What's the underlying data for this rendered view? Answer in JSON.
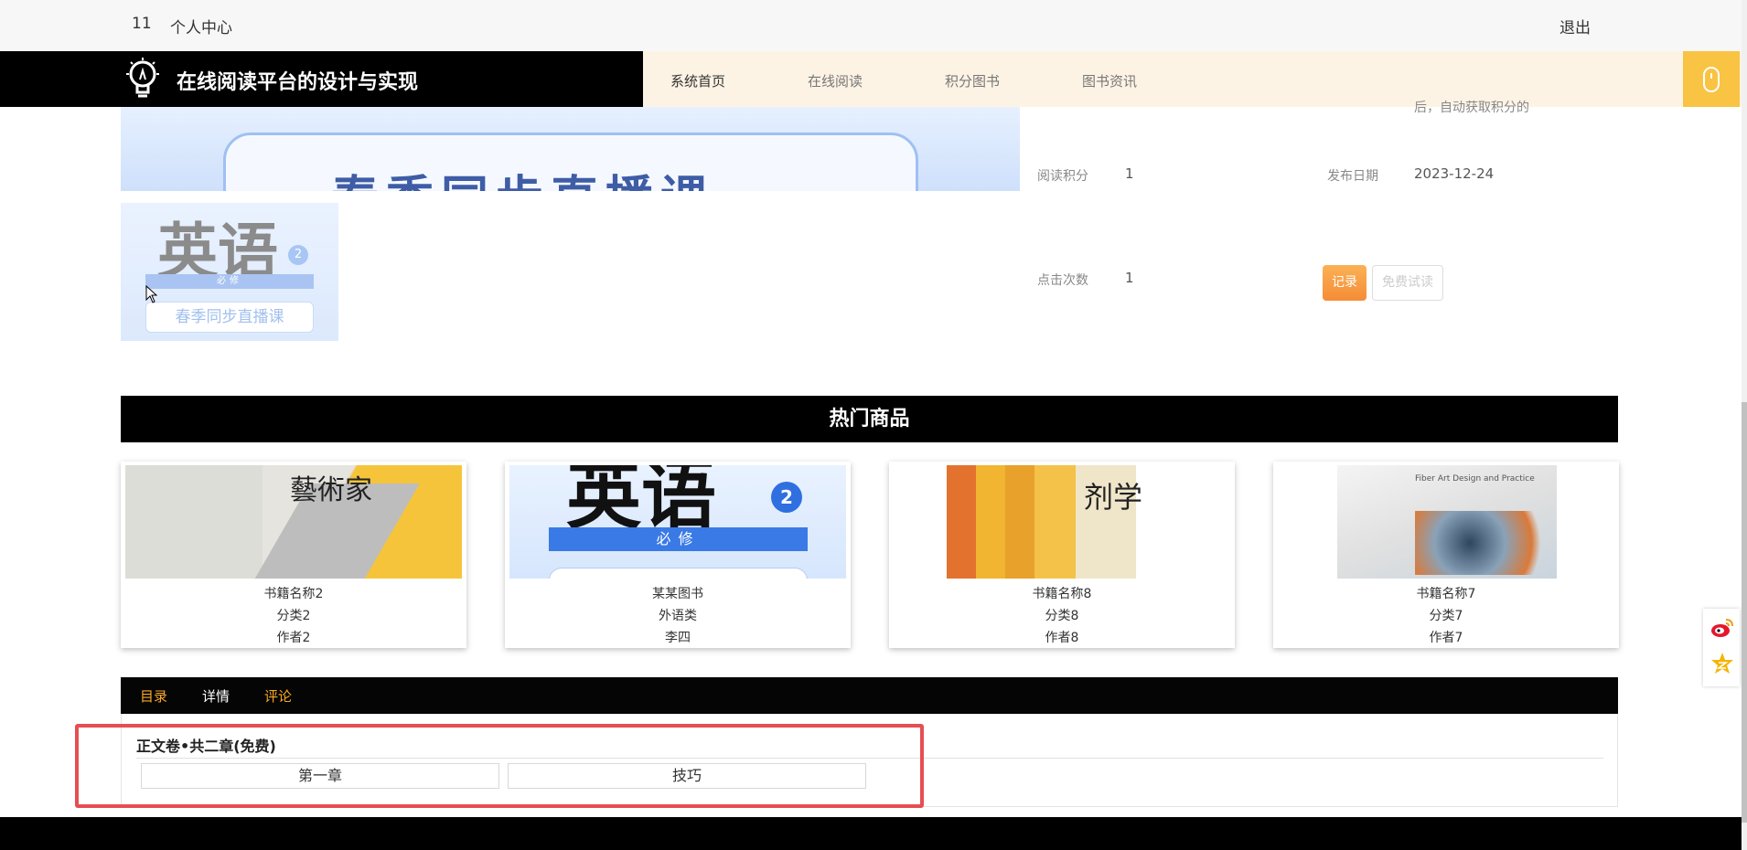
{
  "topbar": {
    "user_id": "11",
    "center_link": "个人中心",
    "logout": "退出"
  },
  "header": {
    "site_title": "在线阅读平台的设计与实现",
    "nav": [
      {
        "label": "系统首页",
        "active": true
      },
      {
        "label": "在线阅读",
        "active": false
      },
      {
        "label": "积分图书",
        "active": false
      },
      {
        "label": "图书资讯",
        "active": false
      }
    ],
    "accent_color": "#f9c343"
  },
  "detail": {
    "partial_text": "后，自动获取积分的",
    "cover_text": "春季同步直播课",
    "thumb": {
      "title": "英语",
      "number": "2",
      "bar_text": "必修",
      "pill_text": "春季同步直播课"
    },
    "read_points_label": "阅读积分",
    "read_points_value": "1",
    "publish_date_label": "发布日期",
    "publish_date_value": "2023-12-24",
    "clicks_label": "点击次数",
    "clicks_value": "1",
    "record_button": "记录",
    "free_trial_button": "免费试读"
  },
  "hot": {
    "title": "热门商品",
    "cards": [
      {
        "name": "书籍名称2",
        "category": "分类2",
        "author": "作者2",
        "cover_text": "藝術家"
      },
      {
        "name": "某某图书",
        "category": "外语类",
        "author": "李四",
        "cover_text": "英语",
        "cover_num": "2",
        "cover_bar": "必修"
      },
      {
        "name": "书籍名称8",
        "category": "分类8",
        "author": "作者8",
        "cover_text": "剂学"
      },
      {
        "name": "书籍名称7",
        "category": "分类7",
        "author": "作者7",
        "cover_text": "Fiber Art Design and Practice"
      }
    ]
  },
  "tabs": [
    {
      "label": "目录",
      "color": "#f9a825"
    },
    {
      "label": "详情",
      "color": "#ffffff"
    },
    {
      "label": "评论",
      "color": "#f9a825"
    }
  ],
  "catalog": {
    "volume_title": "正文卷•共二章(免费)",
    "chapters": [
      "第一章",
      "技巧"
    ]
  }
}
